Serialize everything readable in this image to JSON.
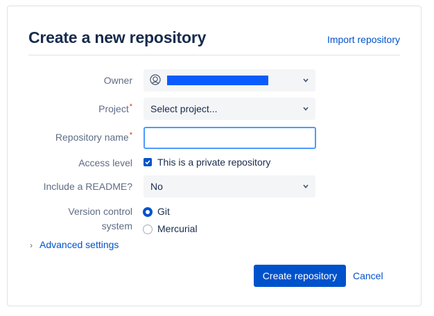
{
  "header": {
    "title": "Create a new repository",
    "import_link": "Import repository"
  },
  "form": {
    "owner": {
      "label": "Owner",
      "value": ""
    },
    "project": {
      "label": "Project",
      "required_mark": "*",
      "value": "Select project..."
    },
    "repo_name": {
      "label": "Repository name",
      "required_mark": "*",
      "value": "",
      "placeholder": ""
    },
    "access": {
      "label": "Access level",
      "checkbox_label": "This is a private repository",
      "checked": true
    },
    "readme": {
      "label": "Include a README?",
      "value": "No"
    },
    "vcs": {
      "label_line1": "Version control",
      "label_line2": "system",
      "options": [
        {
          "label": "Git",
          "selected": true
        },
        {
          "label": "Mercurial",
          "selected": false
        }
      ]
    },
    "advanced": {
      "label": "Advanced settings",
      "arrow": "›"
    }
  },
  "actions": {
    "create": "Create repository",
    "cancel": "Cancel"
  },
  "colors": {
    "accent": "#0052cc",
    "focus": "#4c9aff",
    "required": "#de350b",
    "redaction": "#0a5bff"
  },
  "icons": {
    "owner_avatar": "avatar-icon",
    "dropdown": "chevron-down-icon",
    "checkbox": "checkmark-icon",
    "advanced": "chevron-right-icon"
  }
}
